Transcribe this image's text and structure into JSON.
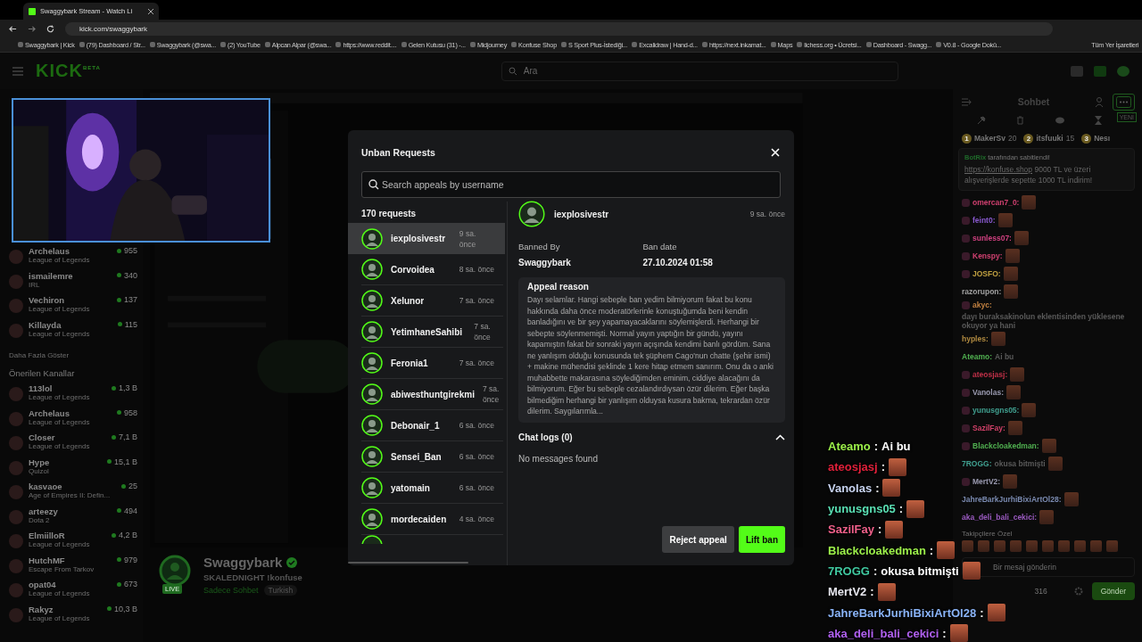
{
  "browser": {
    "tab_title": "Swaggybark Stream - Watch Li",
    "url": "kick.com/swaggybark",
    "bookmarks": [
      "Swaggybark | Kick",
      "(79) Dashboard / Str...",
      "Swaggybark (@swa...",
      "(2) YouTube",
      "Alpcan Alpar (@swa...",
      "https://www.reddit....",
      "Gelen Kutusu (31) -...",
      "Midjourney",
      "Konfuse Shop",
      "S Sport Plus-İstediği...",
      "Excalidraw | Hand-d...",
      "https://next.inkamat...",
      "Maps",
      "lichess.org • Ücretsi...",
      "Dashboard - Swagg...",
      "V0.8 - Google Dokü..."
    ],
    "all_bookmarks": "Tüm Yer İşaretleri"
  },
  "site_header": {
    "logo": "KICK",
    "logo_badge": "BETA",
    "search_placeholder": "Ara"
  },
  "sidebar": {
    "channels": [
      {
        "name": "Archelaus",
        "category": "League of Legends",
        "viewers": "955"
      },
      {
        "name": "ismailemre",
        "category": "IRL",
        "viewers": "340"
      },
      {
        "name": "Vechiron",
        "category": "League of Legends",
        "viewers": "137"
      },
      {
        "name": "Killayda",
        "category": "League of Legends",
        "viewers": "115"
      }
    ],
    "show_more": "Daha Fazla Göster",
    "recommended_title": "Önerilen Kanallar",
    "recommended": [
      {
        "name": "113lol",
        "category": "League of Legends",
        "viewers": "1,3 B"
      },
      {
        "name": "Archelaus",
        "category": "League of Legends",
        "viewers": "958"
      },
      {
        "name": "Closer",
        "category": "League of Legends",
        "viewers": "7,1 B"
      },
      {
        "name": "Hype",
        "category": "Quizol",
        "viewers": "15,1 B"
      },
      {
        "name": "kasvaoe",
        "category": "Age of Empires II: Defin...",
        "viewers": "25"
      },
      {
        "name": "arteezy",
        "category": "Dota 2",
        "viewers": "494"
      },
      {
        "name": "ElmiilloR",
        "category": "League of Legends",
        "viewers": "4,2 B"
      },
      {
        "name": "HutchMF",
        "category": "Escape From Tarkov",
        "viewers": "979"
      },
      {
        "name": "opat04",
        "category": "League of Legends",
        "viewers": "673"
      },
      {
        "name": "Rakyz",
        "category": "League of Legends",
        "viewers": "10,3 B"
      }
    ]
  },
  "channel": {
    "name": "Swaggybark",
    "live_badge": "LIVE",
    "title": "SKALEDNIGHT !konfuse",
    "category": "Sadece Sohbet",
    "language": "Turkish"
  },
  "chat": {
    "title": "Sohbet",
    "new_badge": "YENİ",
    "leaderboard": [
      {
        "rank": "1",
        "name": "MakerSv",
        "count": "20"
      },
      {
        "rank": "2",
        "name": "itsfuuki",
        "count": "15"
      },
      {
        "rank": "3",
        "name": "Nesı"
      }
    ],
    "pinned": {
      "author": "BotRix",
      "label": "tarafından sabitlendi!",
      "link": "https://konfuse.shop",
      "text": "9000 TL ve üzeri alışverişlerde sepette 1000 TL indirim!"
    },
    "messages": [
      {
        "user": "omercan7_0:",
        "color": "#d04070",
        "badge": true,
        "emote": true
      },
      {
        "user": "feint0:",
        "color": "#8a5ad0",
        "badge": true,
        "emote": true
      },
      {
        "user": "sunless07:",
        "color": "#d04080",
        "badge": true,
        "emote": true
      },
      {
        "user": "Kenspy:",
        "color": "#d04070",
        "badge": true,
        "emote": true
      },
      {
        "user": "JOSFO:",
        "color": "#c0a040",
        "badge": true,
        "emote": true
      },
      {
        "user": "razorupon:",
        "color": "#a0a0a0",
        "badge": false,
        "emote": true
      },
      {
        "user": "akyc:",
        "color": "#c08040",
        "badge": true,
        "text": "dayı buraksakinolun eklentisinden yüklesene okuyor ya hani",
        "emote": false
      },
      {
        "user": "hyples:",
        "color": "#b08a40",
        "badge": false,
        "emote": true
      },
      {
        "user": "Ateamo:",
        "color": "#50b050",
        "badge": false,
        "text": "Ai bu",
        "emote": false
      },
      {
        "user": "ateosjasj:",
        "color": "#c03048",
        "badge": true,
        "emote": true
      },
      {
        "user": "Vanolas:",
        "color": "#9a9ab0",
        "badge": true,
        "emote": true
      },
      {
        "user": "yunusgns05:",
        "color": "#40a090",
        "badge": true,
        "emote": true
      },
      {
        "user": "SazilFay:",
        "color": "#d04068",
        "badge": true,
        "emote": true
      },
      {
        "user": "Blackcloakedman:",
        "color": "#50b050",
        "badge": true,
        "emote": true
      },
      {
        "user": "7ROGG:",
        "color": "#40a090",
        "badge": false,
        "text": "okusa bitmişti",
        "emote": true
      },
      {
        "user": "MertV2:",
        "color": "#9a9ab0",
        "badge": true,
        "emote": true
      },
      {
        "user": "JahreBarkJurhiBixiArtOl28:",
        "color": "#7a8ab0",
        "badge": false,
        "emote": true
      },
      {
        "user": "aka_deli_bali_cekici:",
        "color": "#9a5ac0",
        "badge": false,
        "emote": true
      }
    ],
    "followers_only": "Takipçilere Özel",
    "input_placeholder": "Bir mesaj gönderin",
    "points": "316",
    "send": "Gönder"
  },
  "stream_overlay_chat": [
    {
      "user": "Ateamo",
      "color": "#9cf04a",
      "colon": ":",
      "text": "Ai bu",
      "emote": false
    },
    {
      "user": "ateosjasj",
      "color": "#e0203a",
      "colon": ":",
      "emote": true
    },
    {
      "user": "Vanolas",
      "color": "#c8d4f0",
      "colon": ":",
      "emote": true
    },
    {
      "user": "yunusgns05",
      "color": "#5ae0b4",
      "colon": ":",
      "emote": true
    },
    {
      "user": "SazilFay",
      "color": "#f0608a",
      "colon": ":",
      "emote": true
    },
    {
      "user": "Blackcloakedman",
      "color": "#9cf04a",
      "colon": ":",
      "emote": true
    },
    {
      "user": "7ROGG",
      "color": "#40c8a0",
      "colon": ":",
      "text": "okusa bitmişti",
      "emote": true
    },
    {
      "user": "MertV2",
      "color": "#e8e8f0",
      "colon": ":",
      "emote": true
    },
    {
      "user": "JahreBarkJurhiBixiArtOl28",
      "color": "#8ab4f8",
      "colon": ":",
      "emote": true
    },
    {
      "user": "aka_deli_bali_cekici",
      "color": "#b060f0",
      "colon": ":",
      "emote": true
    }
  ],
  "modal": {
    "title": "Unban Requests",
    "search_placeholder": "Search appeals by username",
    "count": "170 requests",
    "requests": [
      {
        "name": "iexplosivestr",
        "time": "9 sa. önce",
        "selected": true
      },
      {
        "name": "Corvoidea",
        "time": "8 sa. önce",
        "selected": false
      },
      {
        "name": "Xelunor",
        "time": "7 sa. önce",
        "selected": false
      },
      {
        "name": "YetimhaneSahibi",
        "time": "7 sa. önce",
        "selected": false
      },
      {
        "name": "Feronia1",
        "time": "7 sa. önce",
        "selected": false
      },
      {
        "name": "abiwesthuntgirekmi",
        "time": "7 sa. önce",
        "selected": false
      },
      {
        "name": "Debonair_1",
        "time": "6 sa. önce",
        "selected": false
      },
      {
        "name": "Sensei_Ban",
        "time": "6 sa. önce",
        "selected": false
      },
      {
        "name": "yatomain",
        "time": "6 sa. önce",
        "selected": false
      },
      {
        "name": "mordecaiden",
        "time": "4 sa. önce",
        "selected": false
      }
    ],
    "detail": {
      "name": "iexplosivestr",
      "time": "9 sa. önce",
      "banned_by_label": "Banned By",
      "banned_by": "Swaggybark",
      "ban_date_label": "Ban date",
      "ban_date": "27.10.2024 01:58",
      "reason_title": "Appeal reason",
      "reason": "Dayı selamlar. Hangi sebeple ban yedim bilmiyorum fakat bu konu hakkında daha önce moderatörlerinle konuştuğumda beni kendin banladığını ve bir şey yapamayacaklarını söylemişlerdi. Herhangi bir sebepte söylenmemişti. Normal yayın yaptığın bir gündü, yayını kapamıştın fakat bir sonraki yayın açışında kendimi banlı gördüm. Sana ne yanlışım olduğu konusunda tek şüphem Cago'nun chatte (şehir ismi) + makine mühendisi şeklinde 1 kere hitap etmem sanırım. Onu da o anki muhabbette makarasına söylediğimden eminim, ciddiye alacağını da bilmiyorum. Eğer bu sebeple cezalandırdıysan özür dilerim. Eğer başka bilmediğim herhangi bir yanlışım olduysa kusura bakma, tekrardan özür dilerim. Saygılarımla...",
      "chat_logs": "Chat logs (0)",
      "chat_logs_expanded": true,
      "no_messages": "No messages found",
      "reject": "Reject appeal",
      "lift": "Lift ban"
    }
  }
}
